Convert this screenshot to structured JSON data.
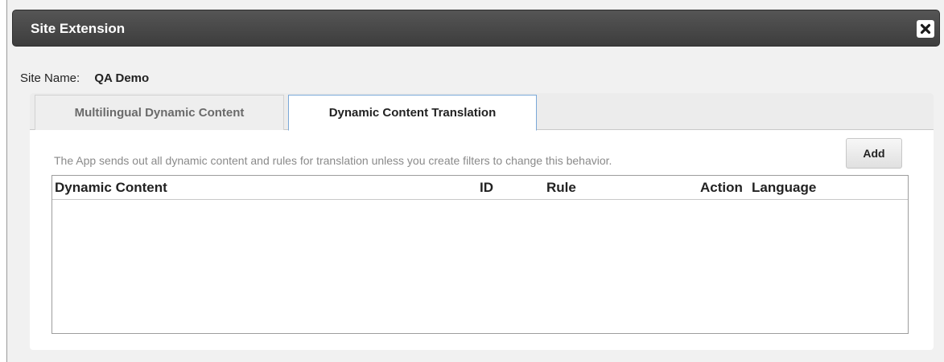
{
  "dialog": {
    "title": "Site Extension",
    "close_icon": "close-icon"
  },
  "site": {
    "label": "Site Name:",
    "value": "QA Demo"
  },
  "tabs": [
    {
      "label": "Multilingual Dynamic Content",
      "active": false
    },
    {
      "label": "Dynamic Content Translation",
      "active": true
    }
  ],
  "panel": {
    "info": "The App sends out all dynamic content and rules for translation unless you create filters to change this behavior.",
    "add_label": "Add"
  },
  "table": {
    "columns": [
      "Dynamic Content",
      "ID",
      "Rule",
      "Action",
      "Language"
    ],
    "rows": []
  },
  "colors": {
    "titlebar": "#444444",
    "active_tab_border": "#7aa8d8",
    "dialog_background": "#f1f1f1"
  }
}
